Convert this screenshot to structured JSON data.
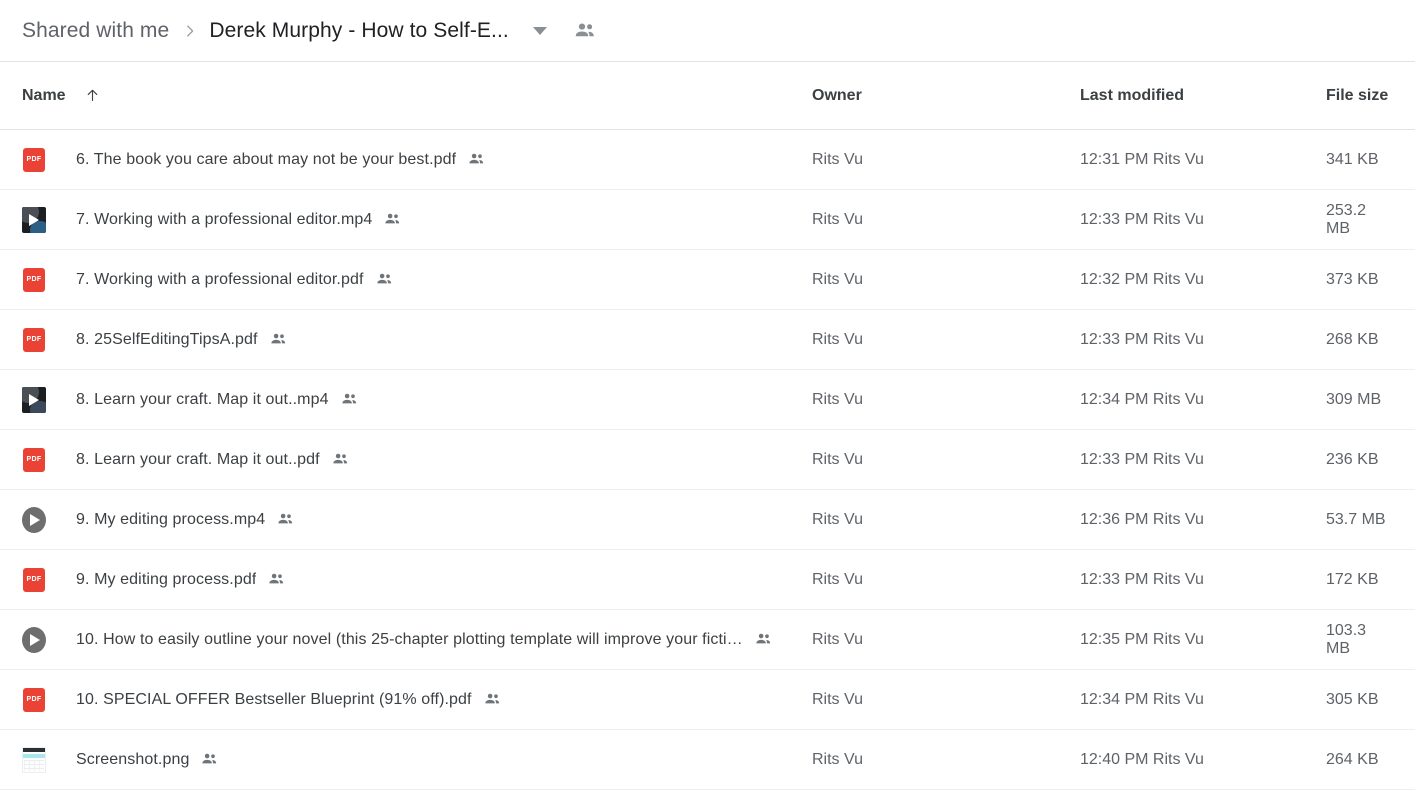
{
  "breadcrumb": {
    "root_label": "Shared with me",
    "separator": "chevron-right-icon",
    "current_label": "Derek Murphy - How to Self-E...",
    "caret": "chevron-down-icon",
    "people": "people-shared-icon"
  },
  "columns": {
    "name": "Name",
    "sort_indicator": "arrow-up-icon",
    "owner": "Owner",
    "last_modified": "Last modified",
    "file_size": "File size"
  },
  "files": [
    {
      "icon": "pdf-icon",
      "icon_label": "PDF",
      "name": "6. The book you care about may not be your best.pdf",
      "shared": "people-shared-icon",
      "owner": "Rits Vu",
      "modified": "12:31 PM  Rits Vu",
      "size": "341 KB"
    },
    {
      "icon": "video-thumbnail-icon",
      "icon_label": "",
      "name": "7. Working with a professional editor.mp4",
      "shared": "people-shared-icon",
      "owner": "Rits Vu",
      "modified": "12:33 PM  Rits Vu",
      "size": "253.2 MB"
    },
    {
      "icon": "pdf-icon",
      "icon_label": "PDF",
      "name": "7. Working with a professional editor.pdf",
      "shared": "people-shared-icon",
      "owner": "Rits Vu",
      "modified": "12:32 PM  Rits Vu",
      "size": "373 KB"
    },
    {
      "icon": "pdf-icon",
      "icon_label": "PDF",
      "name": "8. 25SelfEditingTipsA.pdf",
      "shared": "people-shared-icon",
      "owner": "Rits Vu",
      "modified": "12:33 PM  Rits Vu",
      "size": "268 KB"
    },
    {
      "icon": "video-thumbnail-icon",
      "icon_label": "",
      "name": "8. Learn your craft. Map it out..mp4",
      "shared": "people-shared-icon",
      "owner": "Rits Vu",
      "modified": "12:34 PM  Rits Vu",
      "size": "309 MB"
    },
    {
      "icon": "pdf-icon",
      "icon_label": "PDF",
      "name": "8. Learn your craft. Map it out..pdf",
      "shared": "people-shared-icon",
      "owner": "Rits Vu",
      "modified": "12:33 PM  Rits Vu",
      "size": "236 KB"
    },
    {
      "icon": "video-play-circle-icon",
      "icon_label": "",
      "name": "9. My editing process.mp4",
      "shared": "people-shared-icon",
      "owner": "Rits Vu",
      "modified": "12:36 PM  Rits Vu",
      "size": "53.7 MB"
    },
    {
      "icon": "pdf-icon",
      "icon_label": "PDF",
      "name": "9. My editing process.pdf",
      "shared": "people-shared-icon",
      "owner": "Rits Vu",
      "modified": "12:33 PM  Rits Vu",
      "size": "172 KB"
    },
    {
      "icon": "video-play-circle-icon",
      "icon_label": "",
      "name": "10. How to easily outline your novel (this 25-chapter plotting template will improve your ficti…",
      "shared": "people-shared-icon",
      "owner": "Rits Vu",
      "modified": "12:35 PM  Rits Vu",
      "size": "103.3 MB"
    },
    {
      "icon": "pdf-icon",
      "icon_label": "PDF",
      "name": "10. SPECIAL OFFER Bestseller Blueprint (91% off).pdf",
      "shared": "people-shared-icon",
      "owner": "Rits Vu",
      "modified": "12:34 PM  Rits Vu",
      "size": "305 KB"
    },
    {
      "icon": "image-thumbnail-icon",
      "icon_label": "",
      "name": "Screenshot.png",
      "shared": "people-shared-icon",
      "owner": "Rits Vu",
      "modified": "12:40 PM  Rits Vu",
      "size": "264 KB"
    }
  ],
  "colors": {
    "pdf_red": "#ea4335",
    "text_primary": "#3c4043",
    "text_secondary": "#5f6368",
    "divider": "#e3e3e3"
  }
}
